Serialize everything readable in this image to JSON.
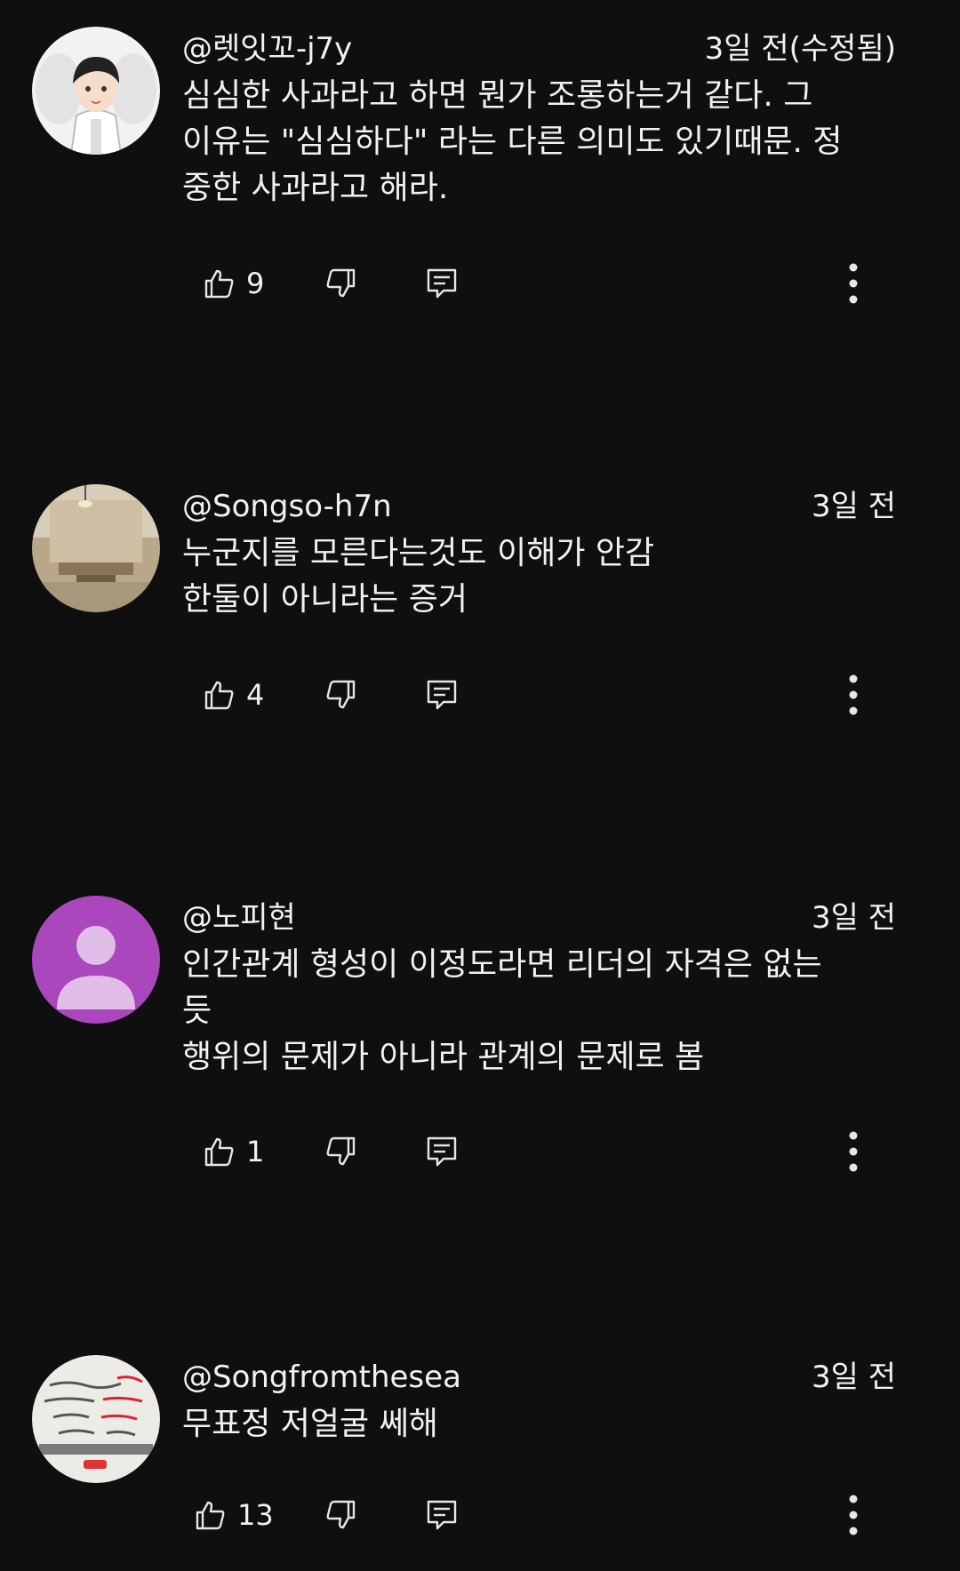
{
  "comments": [
    {
      "handle": "@렛잇꼬-j7y",
      "time": "3일 전(수정됨)",
      "lines": [
        "심심한 사과라고 하면 뭔가 조롱하는거 같다. 그",
        "이유는 \"심심하다\" 라는 다른 의미도 있기때문. 정",
        "중한 사과라고 해라."
      ],
      "likes": "9",
      "avatar": "cartoon-character"
    },
    {
      "handle": "@Songso-h7n",
      "time": "3일 전",
      "lines": [
        "누군지를 모른다는것도 이해가 안감",
        "한둘이 아니라는 증거"
      ],
      "likes": "4",
      "avatar": "room-photo"
    },
    {
      "handle": "@노피현",
      "time": "3일 전",
      "lines": [
        "인간관계 형성이 이정도라면 리더의 자격은 없는",
        "듯",
        "행위의 문제가 아니라 관계의 문제로 봄"
      ],
      "likes": "1",
      "avatar": "default-person",
      "avatar_color": "#ab47bc"
    },
    {
      "handle": "@Songfromthesea",
      "time": "3일 전",
      "lines": [
        "무표정 저얼굴 쎄해"
      ],
      "likes": "13",
      "avatar": "handwritten-note-photo"
    }
  ],
  "colors": {
    "background": "#0f0f0f",
    "text": "#f1f1f1",
    "icon": "#e6e6e6"
  },
  "icons": {
    "like": "thumbs-up-icon",
    "dislike": "thumbs-down-icon",
    "reply": "comment-reply-icon",
    "more": "more-vertical-icon"
  }
}
